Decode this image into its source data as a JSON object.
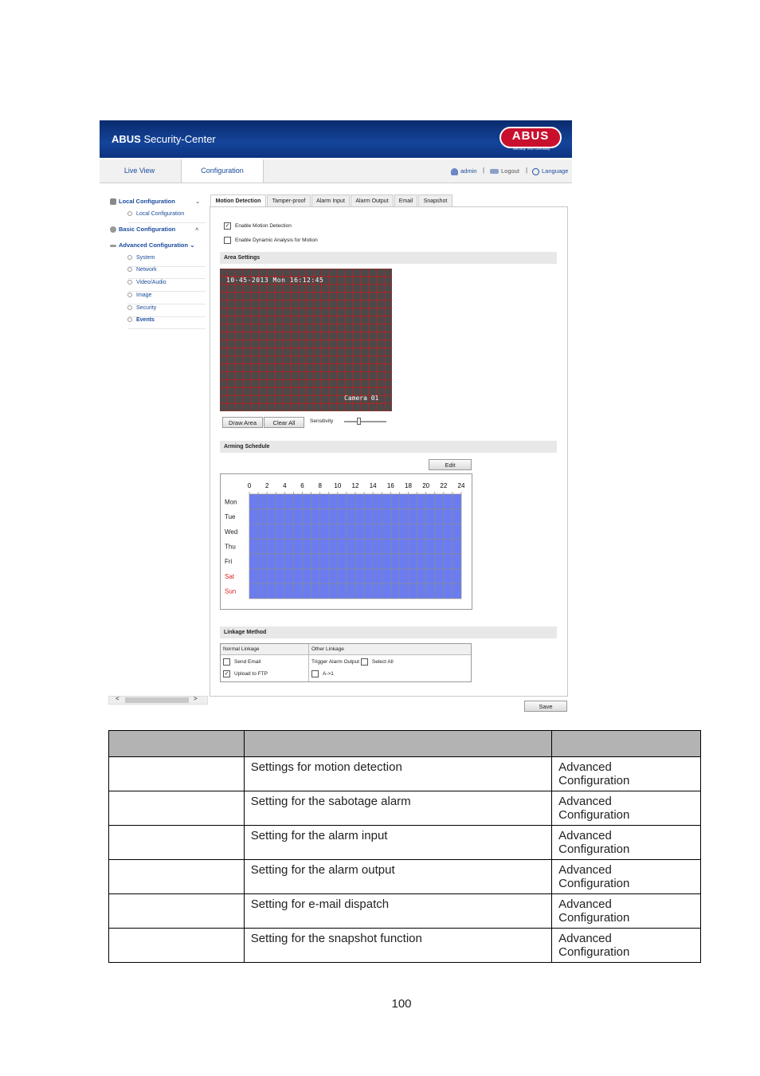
{
  "header": {
    "brand": "ABUS",
    "title_rest": " Security-Center",
    "logo": "ABUS",
    "logo_sub": "Security Tech Germany"
  },
  "nav": {
    "live_view": "Live View",
    "configuration": "Configuration",
    "user": "admin",
    "logout": "Logout",
    "language": "Language",
    "sep": "|"
  },
  "sidebar": {
    "local_config": "Local Configuration",
    "local_config_sub": "Local Configuration",
    "basic_config": "Basic Configuration",
    "advanced_config": "Advanced Configuration",
    "items": [
      "System",
      "Network",
      "Video/Audio",
      "Image",
      "Security",
      "Events"
    ],
    "chev_down": "⌄",
    "chev_up": "˄"
  },
  "tabs": [
    "Motion Detection",
    "Tamper-proof",
    "Alarm Input",
    "Alarm Output",
    "Email",
    "Snapshot"
  ],
  "motion": {
    "enable_label": "Enable Motion Detection",
    "enable_checked": true,
    "dynamic_label": "Enable Dynamic Analysis for Motion",
    "dynamic_checked": false,
    "area_settings": "Area Settings",
    "osd_time": "10-45-2013 Mon 16:12:45",
    "osd_camera": "Camera 01",
    "draw_area": "Draw Area",
    "clear_all": "Clear All",
    "sensitivity": "Sensitivity",
    "arming_schedule": "Arming Schedule",
    "edit": "Edit",
    "hours": [
      "0",
      "2",
      "4",
      "6",
      "8",
      "10",
      "12",
      "14",
      "16",
      "18",
      "20",
      "22",
      "24"
    ],
    "days": [
      "Mon",
      "Tue",
      "Wed",
      "Thu",
      "Fri",
      "Sat",
      "Sun"
    ],
    "weekend_color": "#e02020",
    "schedule_color": "#6b7cf0",
    "linkage_method": "Linkage Method",
    "normal_linkage": "Normal Linkage",
    "other_linkage": "Other Linkage",
    "send_email": "Send Email",
    "send_email_checked": false,
    "upload_ftp": "Upload to FTP",
    "upload_ftp_checked": true,
    "trigger_output": "Trigger Alarm Output",
    "select_all": "Select All",
    "a1": "A->1",
    "save": "Save"
  },
  "scroll": {
    "left": "<",
    "right": ">"
  },
  "doc_table": {
    "rows": [
      {
        "desc": "Settings for motion detection",
        "path_1": "Advanced",
        "path_2": "Configuration"
      },
      {
        "desc": "Setting for the sabotage alarm",
        "path_1": "Advanced",
        "path_2": "Configuration"
      },
      {
        "desc": "Setting for the alarm input",
        "path_1": "Advanced",
        "path_2": "Configuration"
      },
      {
        "desc": "Setting for the alarm output",
        "path_1": "Advanced",
        "path_2": "Configuration"
      },
      {
        "desc": "Setting for e-mail dispatch",
        "path_1": "Advanced",
        "path_2": "Configuration"
      },
      {
        "desc": "Setting for the snapshot function",
        "path_1": "Advanced",
        "path_2": "Configuration"
      }
    ]
  },
  "page_number": "100"
}
